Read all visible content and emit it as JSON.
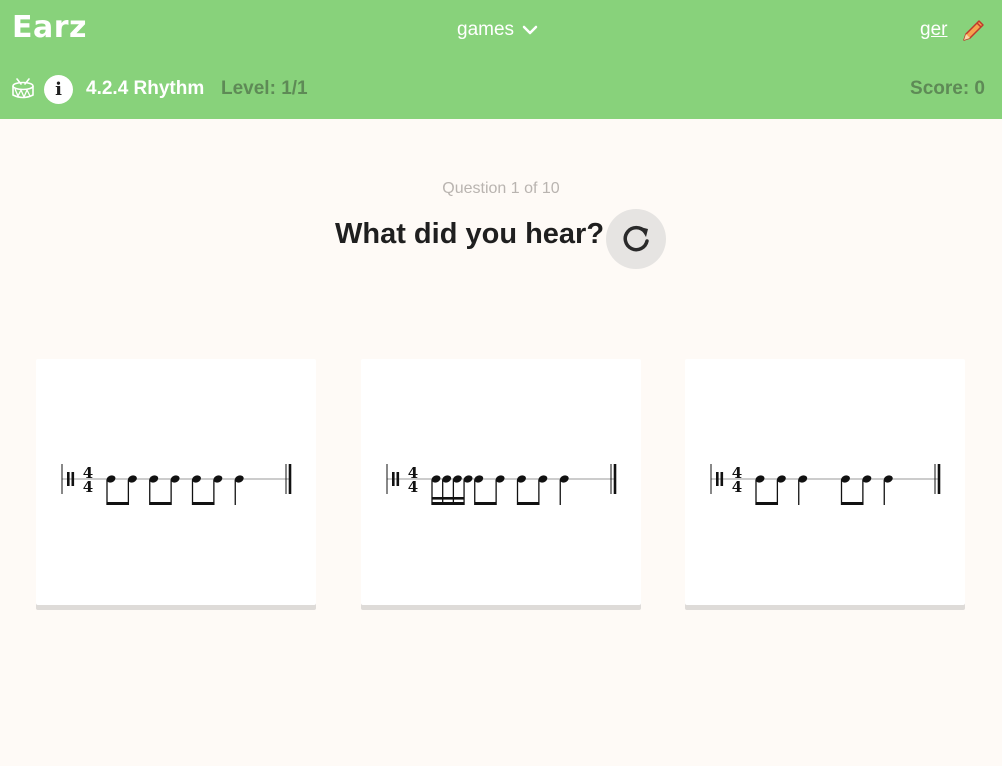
{
  "header": {
    "logo": "Earz",
    "games_label": "games",
    "user_label": "ger",
    "exercise_title": "4.2.4 Rhythm",
    "level_text": "Level: 1/1",
    "score_text": "Score: 0",
    "accent_color": "#88d27b"
  },
  "question": {
    "counter": "Question 1 of 10",
    "prompt": "What did you hear?",
    "replay_icon": "replay-icon"
  },
  "options": [
    {
      "time_signature": "4/4",
      "pattern": [
        "8",
        "8",
        "8",
        "8",
        "8",
        "8",
        "4"
      ]
    },
    {
      "time_signature": "4/4",
      "pattern": [
        "16",
        "16",
        "16",
        "16",
        "8",
        "8",
        "8",
        "8",
        "4"
      ]
    },
    {
      "time_signature": "4/4",
      "pattern": [
        "8",
        "8",
        "4",
        "8",
        "8",
        "4"
      ]
    }
  ]
}
